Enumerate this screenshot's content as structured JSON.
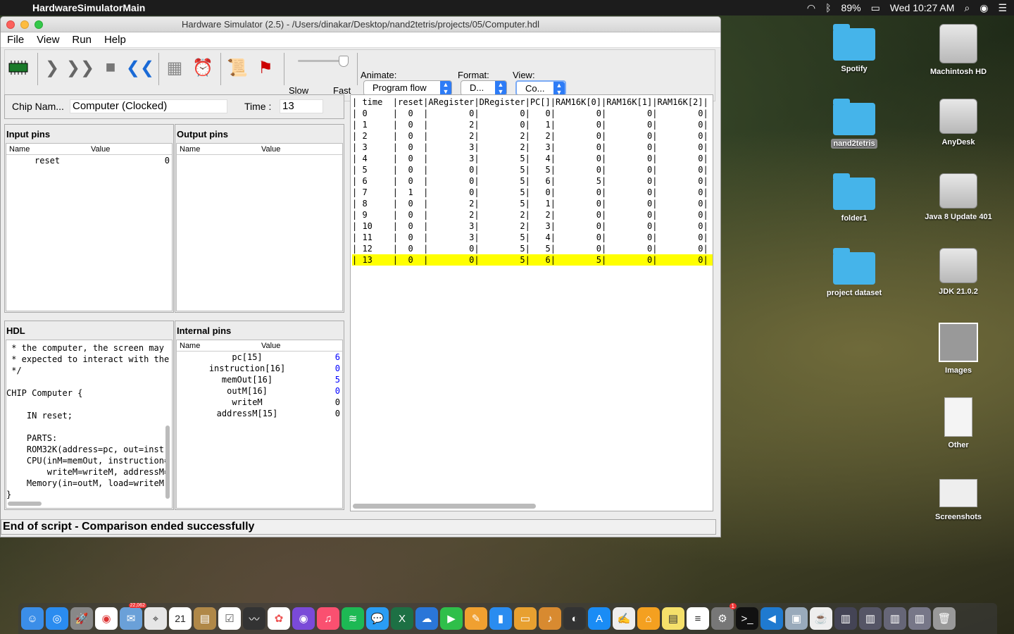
{
  "menubar": {
    "app": "HardwareSimulatorMain",
    "battery": "89%",
    "clock": "Wed 10:27 AM"
  },
  "window": {
    "title": "Hardware Simulator (2.5) - /Users/dinakar/Desktop/nand2tetris/projects/05/Computer.hdl",
    "menus": [
      "File",
      "View",
      "Run",
      "Help"
    ],
    "toolbar": {
      "slow": "Slow",
      "fast": "Fast",
      "animate_label": "Animate:",
      "animate_value": "Program flow",
      "format_label": "Format:",
      "format_value": "D...",
      "view_label": "View:",
      "view_value": "Co..."
    },
    "chip_name_label": "Chip Nam...",
    "chip_name": "Computer (Clocked)",
    "time_label": "Time :",
    "time": "13",
    "input_pins": {
      "title": "Input pins",
      "name_col": "Name",
      "value_col": "Value",
      "rows": [
        {
          "name": "reset",
          "value": "0"
        }
      ]
    },
    "output_pins": {
      "title": "Output pins",
      "name_col": "Name",
      "value_col": "Value"
    },
    "hdl": {
      "title": "HDL",
      "lines": [
        " * the computer, the screen may",
        " * expected to interact with the",
        " */",
        "",
        "CHIP Computer {",
        "",
        "    IN reset;",
        "",
        "    PARTS:",
        "    ROM32K(address=pc, out=instr",
        "    CPU(inM=memOut, instruction=",
        "        writeM=writeM, addressM=",
        "    Memory(in=outM, load=writeM,",
        "}"
      ]
    },
    "internal_pins": {
      "title": "Internal pins",
      "name_col": "Name",
      "value_col": "Value",
      "rows": [
        {
          "name": "pc[15]",
          "value": "6"
        },
        {
          "name": "instruction[16]",
          "value": "0"
        },
        {
          "name": "memOut[16]",
          "value": "5"
        },
        {
          "name": "outM[16]",
          "value": "0"
        },
        {
          "name": "writeM",
          "value": "0"
        },
        {
          "name": "addressM[15]",
          "value": "0"
        }
      ]
    },
    "compare": {
      "header": "| time  |reset|ARegister|DRegister|PC[]|RAM16K[0]|RAM16K[1]|RAM16K[2]|",
      "rows": [
        "| 0     |  0  |        0|        0|   0|        0|        0|        0|",
        "| 1     |  0  |        2|        0|   1|        0|        0|        0|",
        "| 2     |  0  |        2|        2|   2|        0|        0|        0|",
        "| 3     |  0  |        3|        2|   3|        0|        0|        0|",
        "| 4     |  0  |        3|        5|   4|        0|        0|        0|",
        "| 5     |  0  |        0|        5|   5|        0|        0|        0|",
        "| 6     |  0  |        0|        5|   6|        5|        0|        0|",
        "| 7     |  1  |        0|        5|   0|        0|        0|        0|",
        "| 8     |  0  |        2|        5|   1|        0|        0|        0|",
        "| 9     |  0  |        2|        2|   2|        0|        0|        0|",
        "| 10    |  0  |        3|        2|   3|        0|        0|        0|",
        "| 11    |  0  |        3|        5|   4|        0|        0|        0|",
        "| 12    |  0  |        0|        5|   5|        0|        0|        0|",
        "| 13    |  0  |        0|        5|   6|        5|        0|        0|"
      ],
      "highlight_index": 13
    },
    "status": "End of script - Comparison ended successfully"
  },
  "desktop": {
    "icons": [
      "Spotify",
      "Machintosh HD",
      "nand2tetris",
      "AnyDesk",
      "folder1",
      "Java 8 Update 401",
      "project dataset",
      "JDK 21.0.2",
      "Images",
      "Other",
      "Screenshots"
    ]
  },
  "dock": {
    "mail_badge": "22,062",
    "calendar_day": "21",
    "settings_badge": "1"
  },
  "colors": {
    "highlight": "#ffff00",
    "accent": "#2e7cf6",
    "value_blue": "#0000ff"
  }
}
